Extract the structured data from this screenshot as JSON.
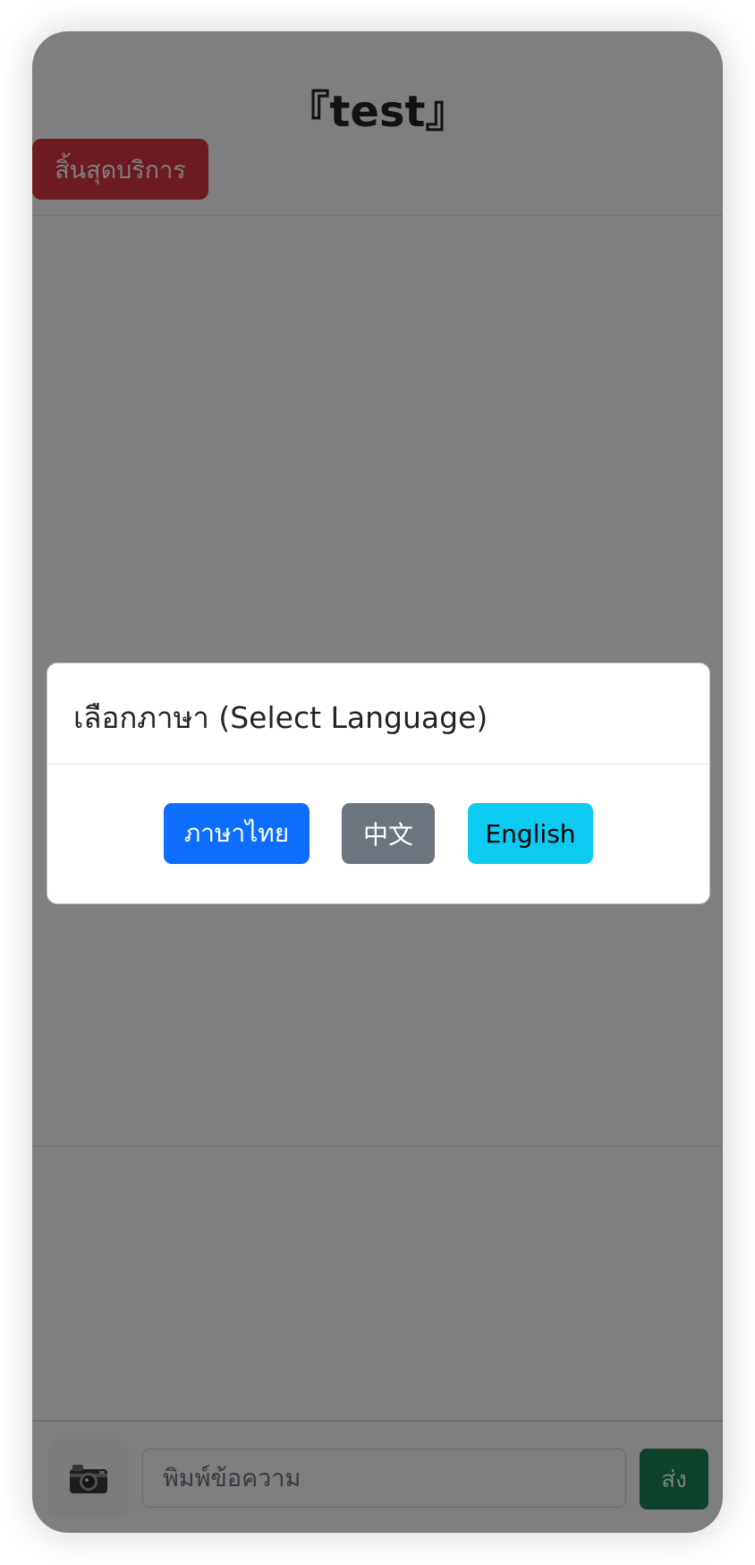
{
  "header": {
    "title": "『test』",
    "end_service_label": "สิ้นสุดบริการ"
  },
  "footer": {
    "camera_icon": "camera-icon",
    "input_placeholder": "พิมพ์ข้อความ",
    "send_label": "ส่ง"
  },
  "modal": {
    "title": "เลือกภาษา (Select Language)",
    "buttons": [
      {
        "label": "ภาษาไทย",
        "color": "#0d6efd"
      },
      {
        "label": "中文",
        "color": "#6c757d"
      },
      {
        "label": "English",
        "color": "#0dcaf0"
      }
    ]
  },
  "colors": {
    "danger": "#dc3545",
    "success": "#198754",
    "backdrop": "rgba(0,0,0,0.5)"
  }
}
